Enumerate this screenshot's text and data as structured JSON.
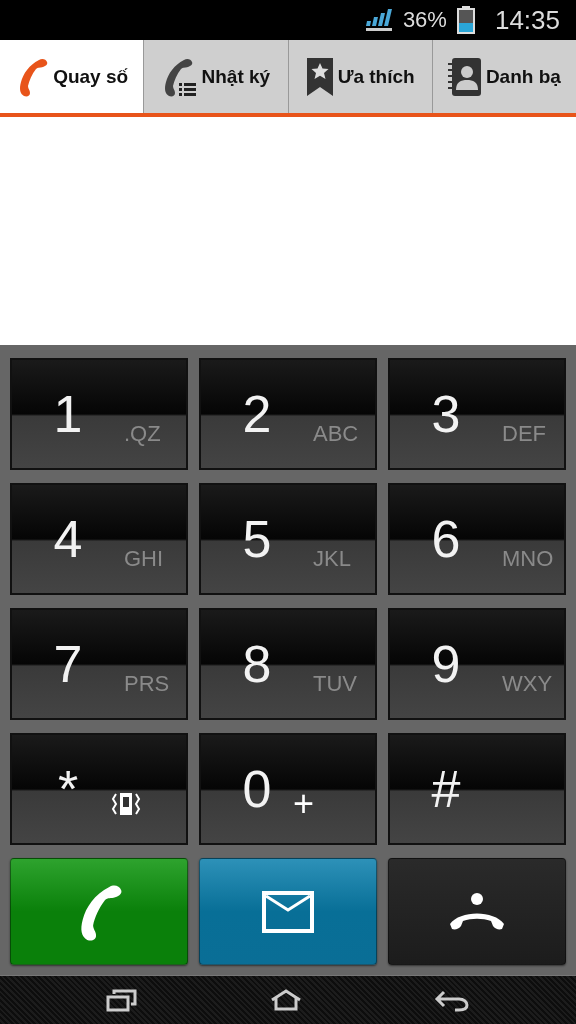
{
  "status_bar": {
    "battery_percent": "36%",
    "time": "14:35"
  },
  "tabs": [
    {
      "label": "Quay số",
      "kind": "phone",
      "selected": true
    },
    {
      "label": "Nhật ký",
      "kind": "call-log",
      "selected": false
    },
    {
      "label": "Ưa thích",
      "kind": "bookmark",
      "selected": false
    },
    {
      "label": "Danh bạ",
      "kind": "contacts",
      "selected": false
    }
  ],
  "keypad": [
    {
      "digit": "1",
      "kind": "letters",
      "letters": ".QZ"
    },
    {
      "digit": "2",
      "kind": "letters",
      "letters": "ABC"
    },
    {
      "digit": "3",
      "kind": "letters",
      "letters": "DEF"
    },
    {
      "digit": "4",
      "kind": "letters",
      "letters": "GHI"
    },
    {
      "digit": "5",
      "kind": "letters",
      "letters": "JKL"
    },
    {
      "digit": "6",
      "kind": "letters",
      "letters": "MNO"
    },
    {
      "digit": "7",
      "kind": "letters",
      "letters": "PRS"
    },
    {
      "digit": "8",
      "kind": "letters",
      "letters": "TUV"
    },
    {
      "digit": "9",
      "kind": "letters",
      "letters": "WXY"
    },
    {
      "digit": "*",
      "kind": "vibrate"
    },
    {
      "digit": "0",
      "kind": "letters",
      "letters": "+"
    },
    {
      "digit": "#",
      "kind": "plain"
    }
  ],
  "actions": [
    {
      "kind": "call"
    },
    {
      "kind": "message"
    },
    {
      "kind": "hangup"
    }
  ],
  "nav": [
    {
      "kind": "recent"
    },
    {
      "kind": "home"
    },
    {
      "kind": "back"
    }
  ]
}
